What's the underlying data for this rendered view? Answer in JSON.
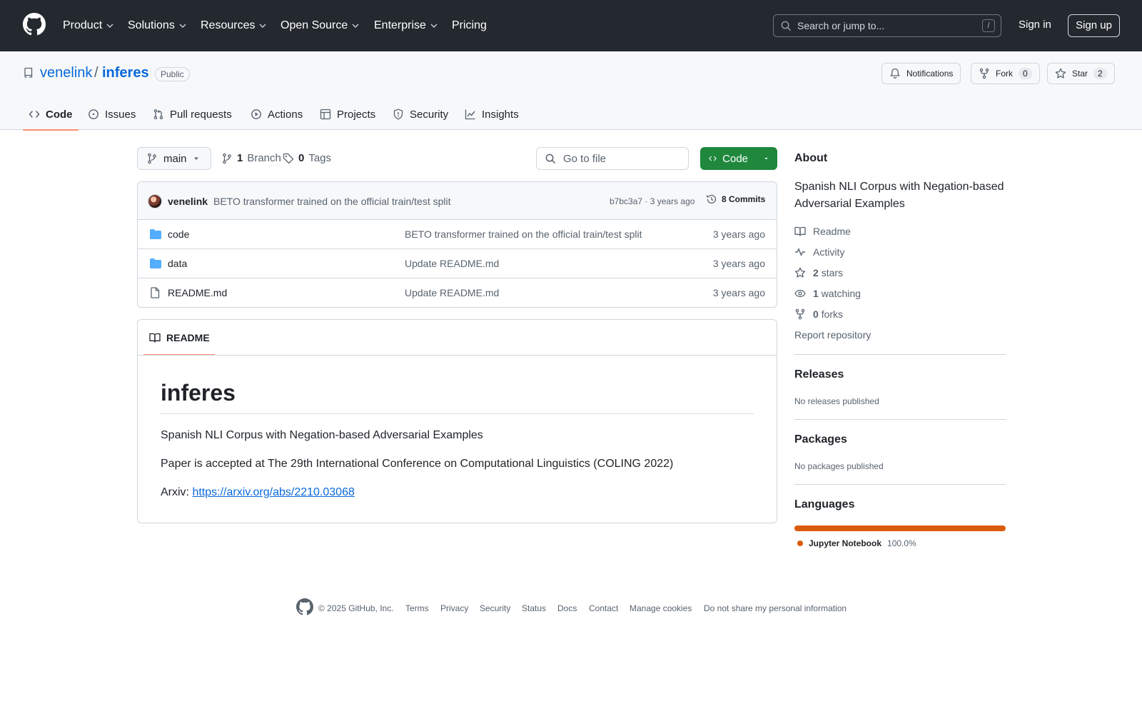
{
  "header": {
    "nav": [
      {
        "label": "Product",
        "has_dropdown": true
      },
      {
        "label": "Solutions",
        "has_dropdown": true
      },
      {
        "label": "Resources",
        "has_dropdown": true
      },
      {
        "label": "Open Source",
        "has_dropdown": true
      },
      {
        "label": "Enterprise",
        "has_dropdown": true
      },
      {
        "label": "Pricing",
        "has_dropdown": false
      }
    ],
    "search_placeholder": "Search or jump to...",
    "search_shortcut": "/",
    "sign_in": "Sign in",
    "sign_up": "Sign up"
  },
  "repo": {
    "owner": "venelink",
    "separator": "/",
    "name": "inferes",
    "visibility": "Public",
    "notifications_label": "Notifications",
    "fork_label": "Fork",
    "fork_count": "0",
    "star_label": "Star",
    "star_count": "2",
    "tabs": [
      {
        "label": "Code",
        "icon": "code-icon",
        "active": true
      },
      {
        "label": "Issues",
        "icon": "issue-icon"
      },
      {
        "label": "Pull requests",
        "icon": "pull-request-icon"
      },
      {
        "label": "Actions",
        "icon": "play-icon"
      },
      {
        "label": "Projects",
        "icon": "table-icon"
      },
      {
        "label": "Security",
        "icon": "shield-icon"
      },
      {
        "label": "Insights",
        "icon": "graph-icon"
      }
    ]
  },
  "toolbar": {
    "branch": "main",
    "branch_count": "1",
    "branch_label": "Branch",
    "tag_count": "0",
    "tag_label": "Tags",
    "goto_placeholder": "Go to file",
    "code_button": "Code"
  },
  "commit": {
    "author": "venelink",
    "message": "BETO transformer trained on the official train/test split",
    "hash": "b7bc3a7 · 3 years ago",
    "commits_label": "8 Commits"
  },
  "files": [
    {
      "name": "code",
      "type": "folder",
      "message": "BETO transformer trained on the official train/test split",
      "time": "3 years ago"
    },
    {
      "name": "data",
      "type": "folder",
      "message": "Update README.md",
      "time": "3 years ago"
    },
    {
      "name": "README.md",
      "type": "file",
      "message": "Update README.md",
      "time": "3 years ago"
    }
  ],
  "readme": {
    "tab_label": "README",
    "title": "inferes",
    "paragraph1": "Spanish NLI Corpus with Negation-based Adversarial Examples",
    "paragraph2": "Paper is accepted at The 29th International Conference on Computational Linguistics (COLING 2022)",
    "arxiv_label": "Arxiv: ",
    "arxiv_url": "https://arxiv.org/abs/2210.03068"
  },
  "sidebar": {
    "about_title": "About",
    "description": "Spanish NLI Corpus with Negation-based Adversarial Examples",
    "readme": "Readme",
    "activity": "Activity",
    "stars_count": "2",
    "stars_label": "stars",
    "watching_count": "1",
    "watching_label": "watching",
    "forks_count": "0",
    "forks_label": "forks",
    "report": "Report repository",
    "releases_title": "Releases",
    "releases_text": "No releases published",
    "packages_title": "Packages",
    "packages_text": "No packages published",
    "languages_title": "Languages",
    "languages": [
      {
        "name": "Jupyter Notebook",
        "percent": "100.0%",
        "fraction": 1.0,
        "color": "#DA5B0B"
      }
    ]
  },
  "footer": {
    "copyright": "© 2025 GitHub, Inc.",
    "links": [
      "Terms",
      "Privacy",
      "Security",
      "Status",
      "Docs",
      "Contact",
      "Manage cookies",
      "Do not share my personal information"
    ]
  },
  "colors": {
    "header_bg": "#24292f",
    "link": "#0969da",
    "primary_button": "#1f883d",
    "active_tab_underline": "#fd8c73",
    "folder": "#54aeff"
  }
}
